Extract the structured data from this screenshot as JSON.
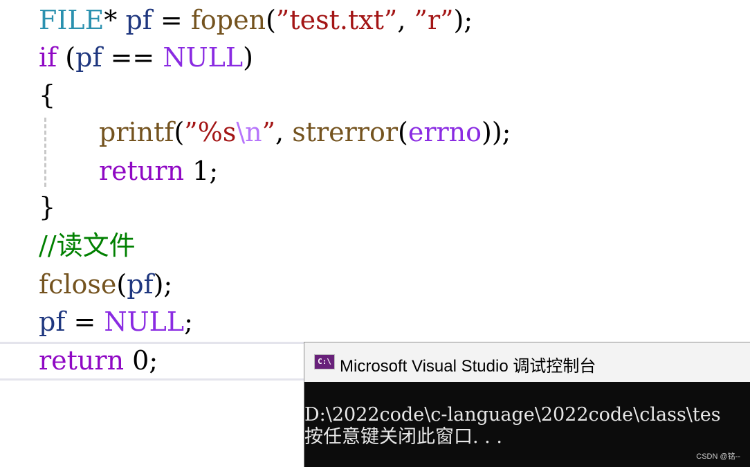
{
  "code_lines": [
    {
      "segments": [
        {
          "t": "FILE",
          "c": "type"
        },
        {
          "t": "* ",
          "c": "op"
        },
        {
          "t": "pf",
          "c": "ident"
        },
        {
          "t": " = ",
          "c": "op"
        },
        {
          "t": "fopen",
          "c": "fn"
        },
        {
          "t": "(",
          "c": "punc"
        },
        {
          "t": "”test.txt”",
          "c": "str"
        },
        {
          "t": ", ",
          "c": "punc"
        },
        {
          "t": "”r”",
          "c": "str"
        },
        {
          "t": ");",
          "c": "punc"
        }
      ]
    },
    {
      "segments": [
        {
          "t": "if",
          "c": "kw"
        },
        {
          "t": " (",
          "c": "punc"
        },
        {
          "t": "pf",
          "c": "ident"
        },
        {
          "t": " == ",
          "c": "op"
        },
        {
          "t": "NULL",
          "c": "macro"
        },
        {
          "t": ")",
          "c": "punc"
        }
      ]
    },
    {
      "segments": [
        {
          "t": "{",
          "c": "punc"
        }
      ]
    },
    {
      "indent": true,
      "segments": [
        {
          "t": "printf",
          "c": "fn"
        },
        {
          "t": "(",
          "c": "punc"
        },
        {
          "t": "”%s",
          "c": "str"
        },
        {
          "t": "\\n",
          "c": "esc"
        },
        {
          "t": "”",
          "c": "str"
        },
        {
          "t": ", ",
          "c": "punc"
        },
        {
          "t": "strerror",
          "c": "fn"
        },
        {
          "t": "(",
          "c": "punc"
        },
        {
          "t": "errno",
          "c": "macro"
        },
        {
          "t": "));",
          "c": "punc"
        }
      ]
    },
    {
      "indent": true,
      "segments": [
        {
          "t": "return",
          "c": "kw"
        },
        {
          "t": " ",
          "c": "punc"
        },
        {
          "t": "1",
          "c": "num"
        },
        {
          "t": ";",
          "c": "punc"
        }
      ]
    },
    {
      "segments": [
        {
          "t": "}",
          "c": "punc"
        }
      ]
    },
    {
      "segments": [
        {
          "t": "//读文件",
          "c": "comment"
        }
      ]
    },
    {
      "segments": [
        {
          "t": "fclose",
          "c": "fn"
        },
        {
          "t": "(",
          "c": "punc"
        },
        {
          "t": "pf",
          "c": "ident"
        },
        {
          "t": ");",
          "c": "punc"
        }
      ]
    },
    {
      "segments": [
        {
          "t": "pf",
          "c": "ident"
        },
        {
          "t": " = ",
          "c": "op"
        },
        {
          "t": "NULL",
          "c": "macro"
        },
        {
          "t": ";",
          "c": "punc"
        }
      ]
    },
    {
      "segments": [
        {
          "t": "return",
          "c": "kw"
        },
        {
          "t": " ",
          "c": "punc"
        },
        {
          "t": "0",
          "c": "num"
        },
        {
          "t": ";",
          "c": "punc"
        }
      ]
    }
  ],
  "console": {
    "icon_label": "C:\\",
    "icon": "vs-console-icon",
    "title": "Microsoft Visual Studio 调试控制台",
    "output_line_1": "D:\\2022code\\c-language\\2022code\\class\\tes",
    "output_line_2": "按任意键关闭此窗口. . ."
  },
  "watermark": "CSDN @铭--",
  "colors": {
    "type": "#2b91af",
    "ident": "#1f377f",
    "function": "#74531f",
    "string": "#a31515",
    "macro": "#8a2be2",
    "keyword": "#8f08c4",
    "comment": "#008000",
    "console_bg": "#0c0c0c",
    "console_title_bg": "#f3f3f3",
    "vs_purple": "#68217a"
  }
}
